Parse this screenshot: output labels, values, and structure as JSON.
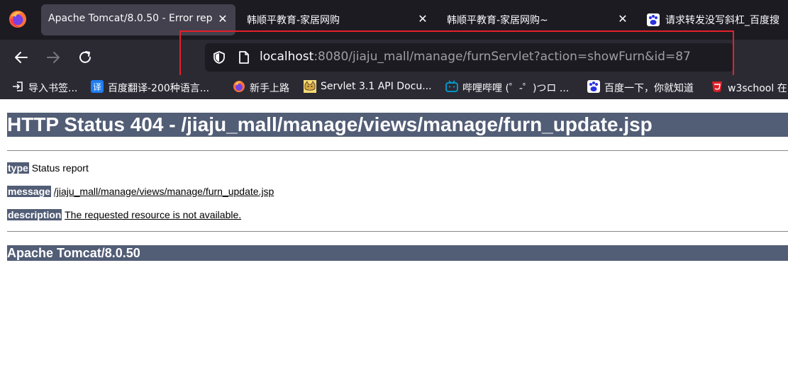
{
  "browser": {
    "tabs": [
      {
        "title": "Apache Tomcat/8.0.50 - Error rep",
        "active": true
      },
      {
        "title": "韩顺平教育-家居网购",
        "active": false
      },
      {
        "title": "韩顺平教育-家居网购~",
        "active": false
      },
      {
        "title": "请求转发没写斜杠_百度搜",
        "active": false
      }
    ],
    "url": {
      "host": "localhost",
      "rest": ":8080/jiaju_mall/manage/furnServlet?action=showFurn&id=87"
    },
    "bookmarks": [
      {
        "label": "导入书签...",
        "icon": "import-icon"
      },
      {
        "label": "百度翻译-200种语言...",
        "icon": "translate-icon"
      },
      {
        "label": "新手上路",
        "icon": "firefox-icon"
      },
      {
        "label": "Servlet 3.1 API Docu...",
        "icon": "tomcat-icon"
      },
      {
        "label": "哔哩哔哩 (゜-゜)つロ ...",
        "icon": "bilibili-icon"
      },
      {
        "label": "百度一下，你就知道",
        "icon": "baidu-icon"
      },
      {
        "label": "w3school 在",
        "icon": "w3school-icon"
      }
    ],
    "colors": {
      "frame": "#1c1b22",
      "toolbar": "#2b2a33",
      "active_tab": "#42414d",
      "highlight": "#e5202a"
    }
  },
  "page": {
    "heading": "HTTP Status 404 - /jiaju_mall/manage/views/manage/furn_update.jsp",
    "type_label": "type",
    "type_value": "Status report",
    "message_label": "message",
    "message_value": "/jiaju_mall/manage/views/manage/furn_update.jsp",
    "description_label": "description",
    "description_value": "The requested resource is not available.",
    "footer": "Apache Tomcat/8.0.50",
    "colors": {
      "header_bg": "#525d76"
    }
  }
}
